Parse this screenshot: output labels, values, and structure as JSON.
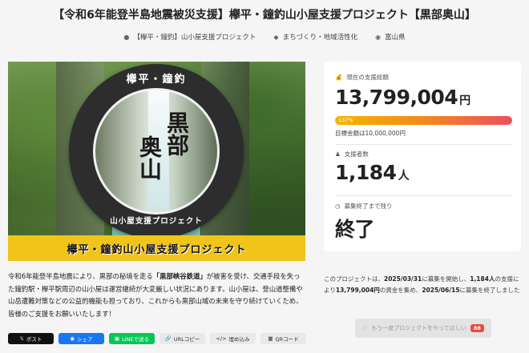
{
  "header": {
    "title": "【令和6年能登半島地震被災支援】欅平・鐘釣山小屋支援プロジェクト【黒部奥山】",
    "owner": "【欅平・鐘釣】山小屋支援プロジェクト",
    "category": "まちづくり・地域活性化",
    "location": "富山県"
  },
  "hero": {
    "seal_top": "欅平・鐘釣",
    "kanji_1": "黒部",
    "kanji_2": "奥山",
    "seal_bottom": "山小屋支援プロジェクト",
    "banner": "欅平・鐘釣山小屋支援プロジェクト"
  },
  "stats": {
    "raised_label": "現在の支援総額",
    "raised_value": "13,799,004",
    "raised_unit": "円",
    "progress_percent_text": "137%",
    "progress_fraction": 1.0,
    "goal_text": "目標金額は10,000,000円",
    "backers_label": "支援者数",
    "backers_value": "1,184",
    "backers_unit": "人",
    "remaining_label": "募集終了まで残り",
    "remaining_value": "終了"
  },
  "description": {
    "p1": "令和6年能登半島地震により、黒部の秘境を走る",
    "p1_bold": "「黒部峡谷鉄道」",
    "p2": "が被害を受け、交通手段を失った鐘釣駅・欅平駅周辺の山小屋は運営継続が大変厳しい状況にあります。山小屋は、登山道整備や山岳遭難対策などの公益的機能も担っており、これからも黒部山域の未来を守り続けていくため、皆様のご支援をお願いいたします！"
  },
  "summary": {
    "t1": "このプロジェクトは、",
    "start": "2025/03/31",
    "t2": "に募集を開始し、",
    "backers": "1,184人",
    "t3": "の支援により",
    "amount": "13,799,004円",
    "t4": "の資金を集め、",
    "end": "2025/06/15",
    "t5": "に募集を終了しました"
  },
  "share": {
    "x": "ポスト",
    "facebook": "シェア",
    "line": "LINEで送る",
    "url": "URLコピー",
    "embed": "埋め込み",
    "qr": "QRコード"
  },
  "again_button": {
    "label": "もう一度プロジェクトをやってほしい",
    "count": "88"
  },
  "colors": {
    "progress_start": "#f5b400",
    "progress_end": "#ee4e5d",
    "banner": "#f0c419",
    "line": "#06c755",
    "facebook": "#1877f2"
  }
}
